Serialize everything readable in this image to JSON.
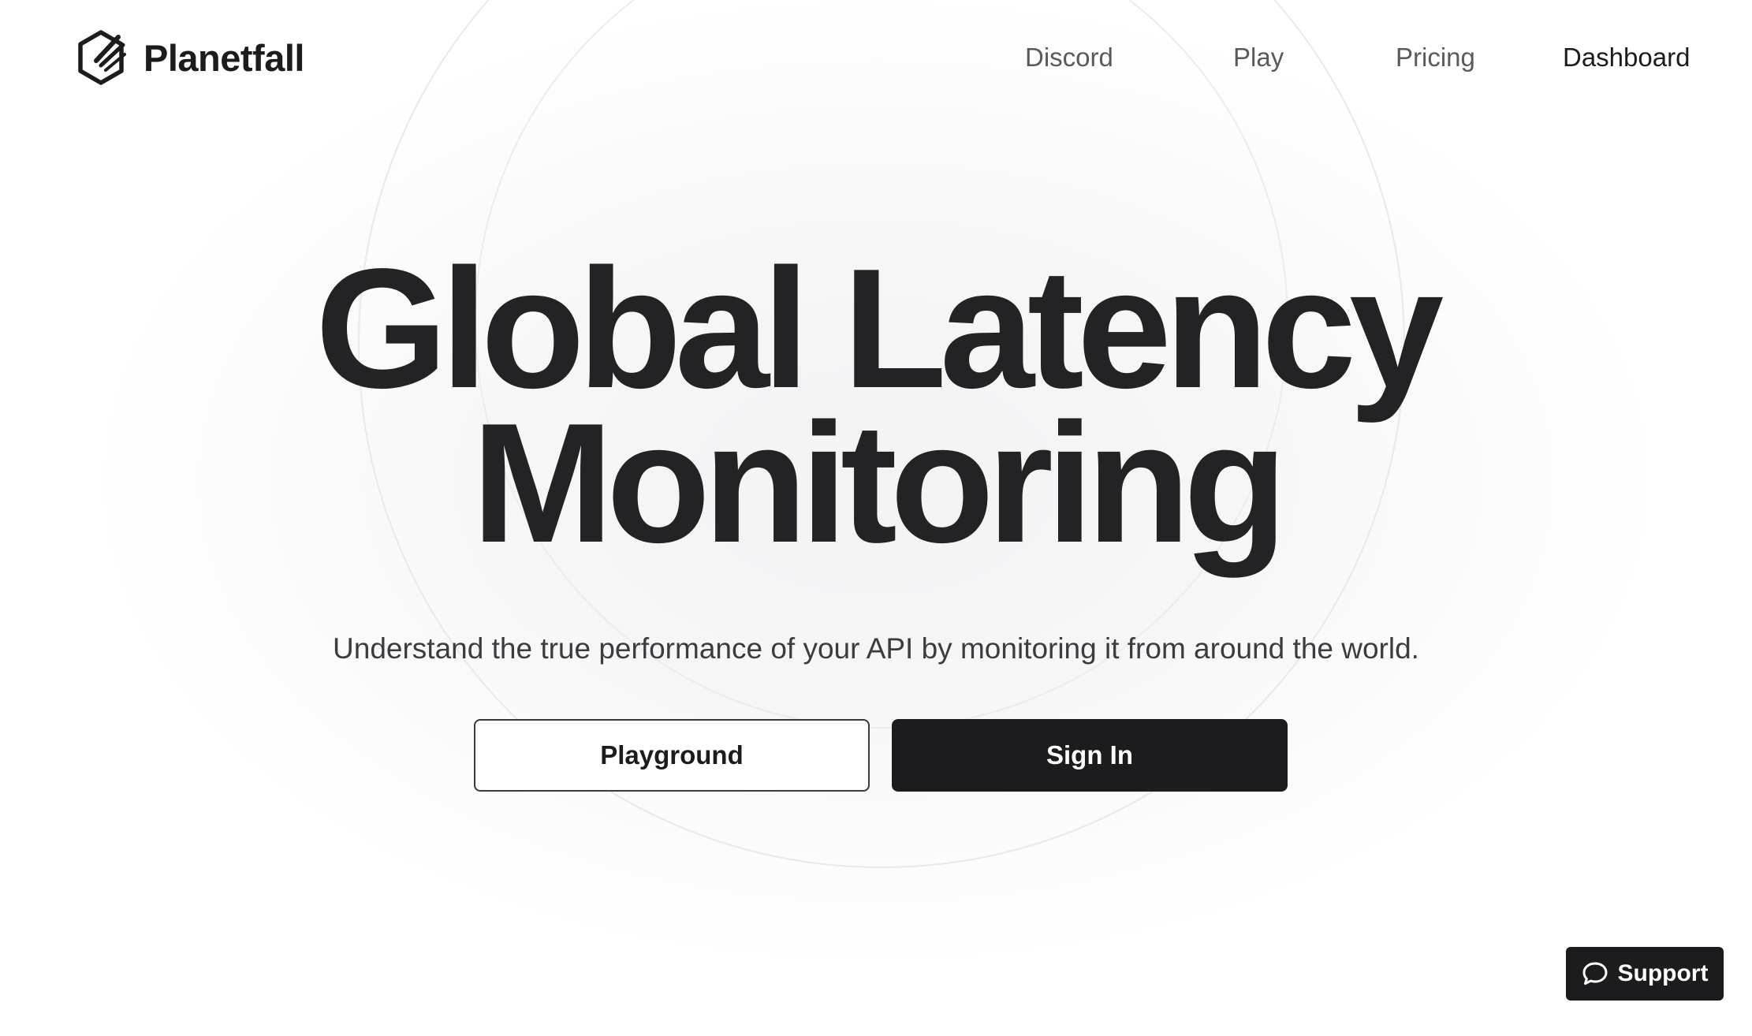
{
  "brand": {
    "name": "Planetfall",
    "logo_icon": "hexagon-logo-icon"
  },
  "nav": {
    "items": [
      {
        "label": "Discord"
      },
      {
        "label": "Play"
      },
      {
        "label": "Pricing"
      },
      {
        "label": "Dashboard"
      }
    ]
  },
  "hero": {
    "title_line1": "Global Latency",
    "title_line2": "Monitoring",
    "subtitle": "Understand the true performance of your API by monitoring it from around the world.",
    "primary_button": "Sign In",
    "secondary_button": "Playground"
  },
  "support": {
    "label": "Support",
    "icon": "chat-bubble-icon"
  },
  "colors": {
    "text_dark": "#1c1c1e",
    "nav_muted": "#5a5a5e",
    "button_dark": "#1c1c1e",
    "background": "#ffffff"
  }
}
